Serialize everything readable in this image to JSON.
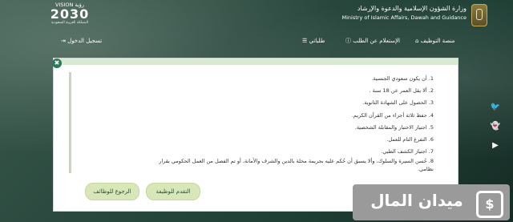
{
  "header": {
    "ministry_ar": "وزارة الشؤون الإسلامية والدعوة والإرشاد",
    "ministry_en": "Ministry of Islamic Affairs, Dawah and Guidance",
    "vision_top": "VISION رؤية",
    "vision_year": "2030",
    "vision_bottom": "المملكة العربية السعودية"
  },
  "nav": {
    "platform": "منصة التوظيف",
    "inquiry": "الإستعلام عن الطلب",
    "requests": "طلباتي",
    "login": "تسجيل الدخول"
  },
  "modal": {
    "requirements": [
      "1. أن يكون سعودي الجنسية.",
      "2. ألا يقل العمر عن 18 سنة .",
      "3. الحصول على الشهادة الثانوية.",
      "4. حفظ ثلاثة أجزاء من القرآن الكريم.",
      "5. اجتياز الاختبار والمقابلة الشخصية.",
      "6. التفرغ التام للعمل.",
      "7. اجتياز الكشف الطبي.",
      "8. حُسن السيرة والسلوك، وألا يسبق أن حُكم عليه بجريمة مخلة بالدين والشرف والأمانة، أو تم الفصل من العمل الحكومي بقرار",
      "نظامي."
    ],
    "apply_button": "التقدم للوظيفة",
    "back_button": "الرجوع للوظائف",
    "close_glyph": "✖"
  },
  "social": {
    "twitter": "🐦",
    "snapchat": "👻",
    "youtube": "▶"
  },
  "watermark": {
    "text": "ميدان المال",
    "icon_glyph": "$"
  },
  "colors": {
    "primary": "#2f7a57",
    "button_bg": "#d9e7b8"
  }
}
